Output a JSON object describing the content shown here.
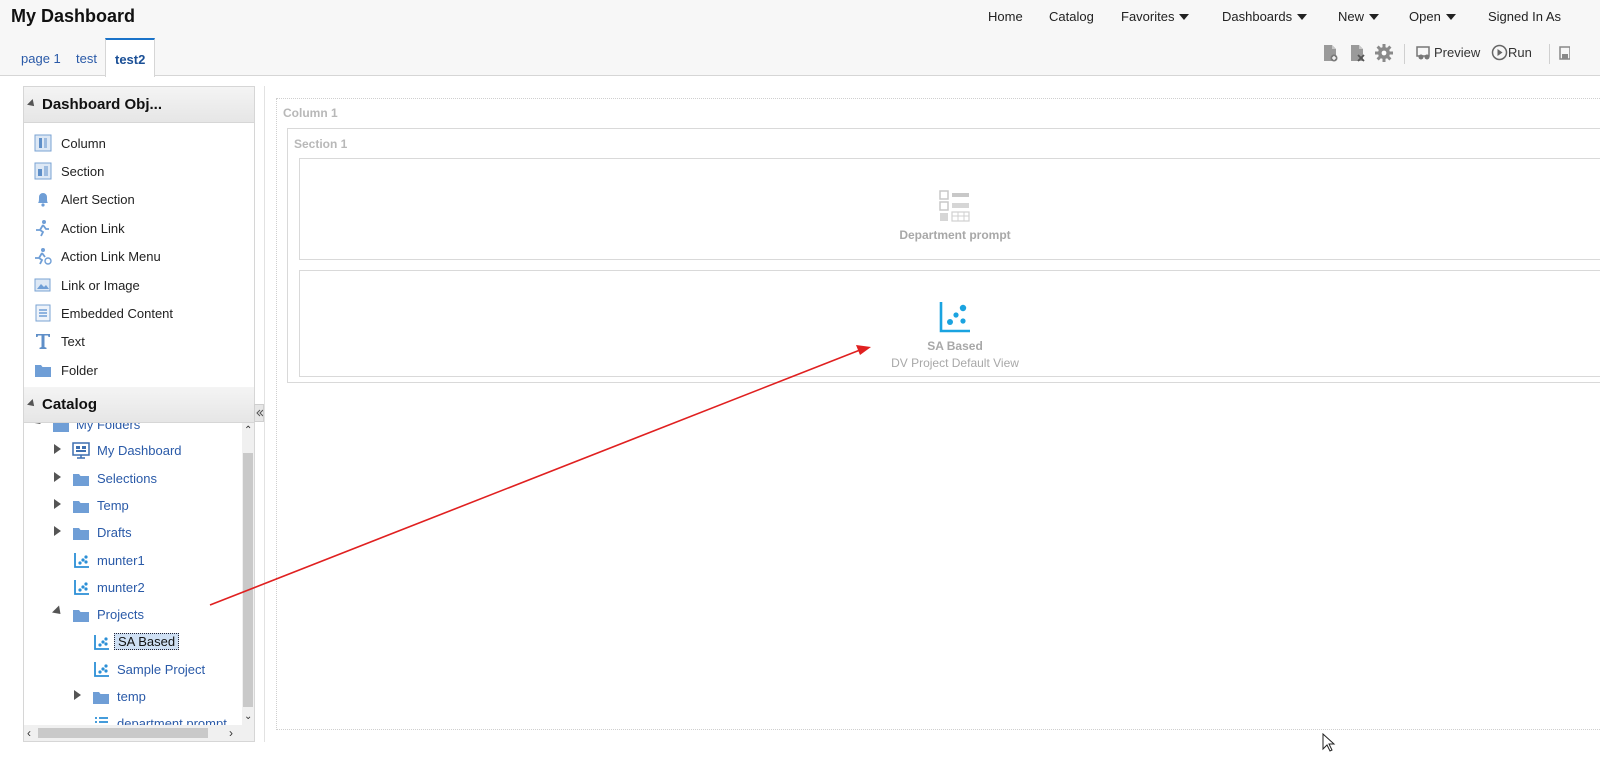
{
  "header": {
    "title": "My Dashboard",
    "nav": [
      {
        "label": "Home"
      },
      {
        "label": "Catalog"
      },
      {
        "label": "Favorites"
      },
      {
        "label": "Dashboards"
      },
      {
        "label": "New"
      },
      {
        "label": "Open"
      },
      {
        "label": "Signed In As"
      }
    ]
  },
  "tabs": [
    {
      "label": "page 1"
    },
    {
      "label": "test"
    },
    {
      "label": "test2",
      "active": true
    }
  ],
  "toolbar": {
    "preview_label": "Preview",
    "run_label": "Run"
  },
  "objects_panel": {
    "title": "Dashboard Obj...",
    "items": [
      {
        "label": "Column",
        "icon": "column-icon"
      },
      {
        "label": "Section",
        "icon": "section-icon"
      },
      {
        "label": "Alert Section",
        "icon": "bell-icon"
      },
      {
        "label": "Action Link",
        "icon": "action-link-icon"
      },
      {
        "label": "Action Link Menu",
        "icon": "action-link-menu-icon"
      },
      {
        "label": "Link or Image",
        "icon": "image-link-icon"
      },
      {
        "label": "Embedded Content",
        "icon": "embedded-content-icon"
      },
      {
        "label": "Text",
        "icon": "text-icon"
      },
      {
        "label": "Folder",
        "icon": "folder-icon"
      }
    ]
  },
  "catalog": {
    "title": "Catalog",
    "tree": [
      {
        "label": "My Folders",
        "icon": "folder-icon"
      },
      {
        "label": "My Dashboard",
        "icon": "dashboard-icon"
      },
      {
        "label": "Selections",
        "icon": "folder-icon"
      },
      {
        "label": "Temp",
        "icon": "folder-icon"
      },
      {
        "label": "Drafts",
        "icon": "folder-icon"
      },
      {
        "label": "munter1",
        "icon": "scatter-chart-icon"
      },
      {
        "label": "munter2",
        "icon": "scatter-chart-icon"
      },
      {
        "label": "Projects",
        "icon": "folder-icon"
      },
      {
        "label": "SA Based",
        "icon": "scatter-chart-icon",
        "selected": true
      },
      {
        "label": "Sample Project",
        "icon": "scatter-chart-icon"
      },
      {
        "label": "temp",
        "icon": "folder-icon"
      },
      {
        "label": "department prompt",
        "icon": "prompt-list-icon"
      }
    ]
  },
  "canvas": {
    "column_title": "Column 1",
    "section_title": "Section 1",
    "prompt_object": {
      "label": "Department prompt",
      "icon": "prompt-icon"
    },
    "dv_object": {
      "label": "SA Based",
      "sublabel": "DV Project Default View",
      "icon": "scatter-chart-icon"
    }
  },
  "colors": {
    "accent": "#1a73c9",
    "link": "#2a5aa8",
    "arrow": "#e02020",
    "dv_icon": "#1aa3e0"
  }
}
